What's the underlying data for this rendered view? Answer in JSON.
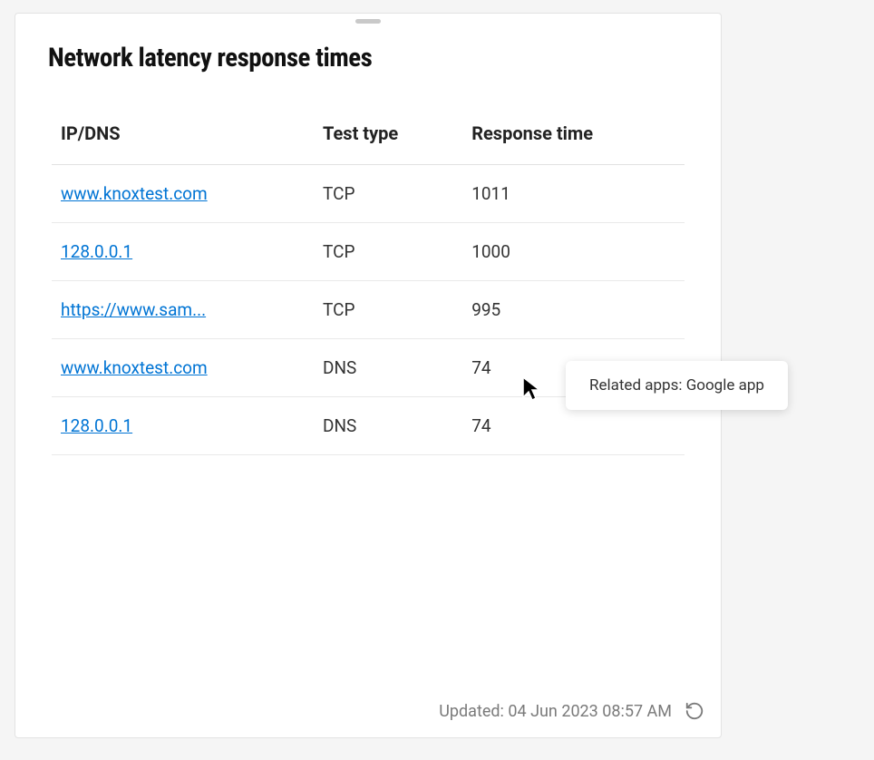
{
  "card": {
    "title": "Network latency response times"
  },
  "table": {
    "columns": {
      "ip_dns": "IP/DNS",
      "test_type": "Test type",
      "response_time": "Response time"
    },
    "rows": [
      {
        "ip_dns": "www.knoxtest.com",
        "test_type": "TCP",
        "response_time": "1011"
      },
      {
        "ip_dns": "128.0.0.1",
        "test_type": "TCP",
        "response_time": "1000"
      },
      {
        "ip_dns": "https://www.sam...",
        "test_type": "TCP",
        "response_time": "995"
      },
      {
        "ip_dns": "www.knoxtest.com",
        "test_type": "DNS",
        "response_time": "74"
      },
      {
        "ip_dns": "128.0.0.1",
        "test_type": "DNS",
        "response_time": "74"
      }
    ]
  },
  "footer": {
    "updated_label": "Updated: 04 Jun 2023 08:57 AM"
  },
  "tooltip": {
    "text": "Related apps: Google app"
  }
}
